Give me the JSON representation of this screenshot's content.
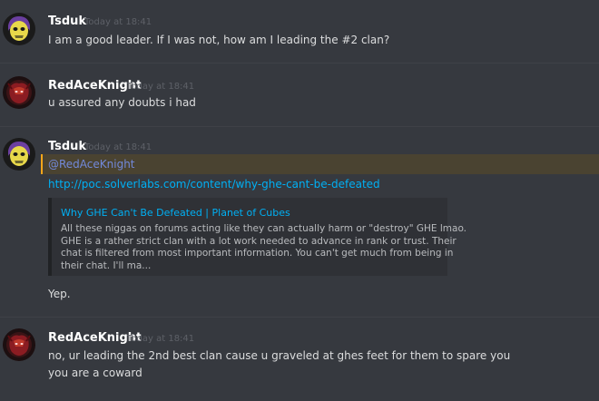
{
  "messages": [
    {
      "author": "Tsduk",
      "timestamp": "Today at 18:41",
      "avatar_icon": "skeletor-icon",
      "lines": [
        "I am a good leader. If I was not, how am I leading the #2 clan?"
      ]
    },
    {
      "author": "RedAceKnight",
      "timestamp": "Today at 18:41",
      "avatar_icon": "red-knight-icon",
      "lines": [
        "u assured any doubts i had"
      ]
    },
    {
      "author": "Tsduk",
      "timestamp": "Today at 18:41",
      "avatar_icon": "skeletor-icon",
      "mention": "@RedAceKnight",
      "link": "http://poc.solverlabs.com/content/why-ghe-cant-be-defeated",
      "embed": {
        "title": "Why GHE Can't Be Defeated | Planet of Cubes",
        "description_lines": [
          "All these niggas on forums acting like they can actually harm or \"destroy\" GHE lmao.",
          "  GHE is a rather strict clan with a lot work needed to advance in rank or trust. Their",
          "chat is filtered from most important information. You can't get much from being in",
          "their chat. I'll ma..."
        ]
      },
      "lines": [
        "Yep."
      ]
    },
    {
      "author": "RedAceKnight",
      "timestamp": "Today at 18:41",
      "avatar_icon": "red-knight-icon",
      "lines": [
        "no, ur leading the 2nd best clan cause u graveled at ghes feet for them to spare you",
        "you are a coward"
      ]
    }
  ],
  "colors": {
    "background": "#36393f",
    "username": "#ffffff",
    "timestamp": "#5d6067",
    "message_text": "#dcddde",
    "mention_text": "#7289da",
    "mention_highlight": "#4a4331",
    "mention_accent": "#faa61a",
    "link": "#00b0f4",
    "embed_bg": "#2f3136"
  }
}
